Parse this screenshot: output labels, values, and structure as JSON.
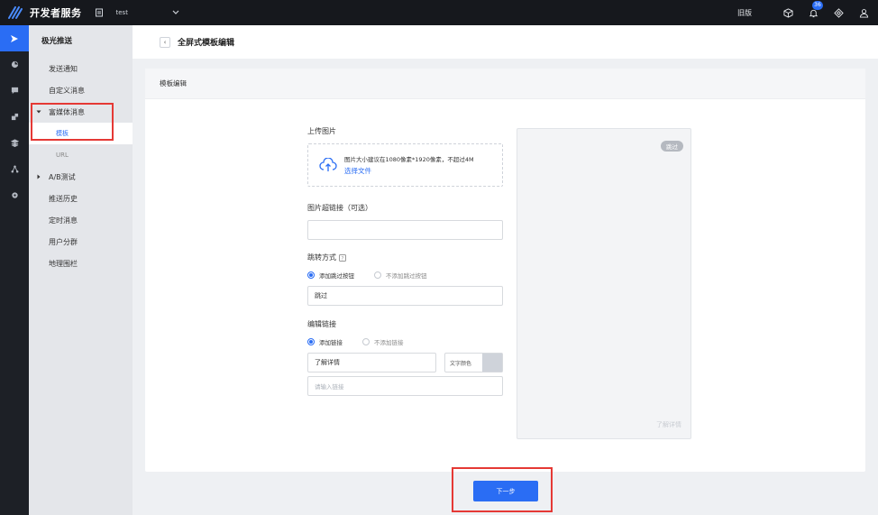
{
  "topbar": {
    "brand": "开发者服务",
    "app_name": "test",
    "old_version": "旧版",
    "notification_count": "36"
  },
  "sidebar": {
    "title": "极光推送",
    "items": [
      {
        "label": "发送通知"
      },
      {
        "label": "自定义消息"
      },
      {
        "label": "富媒体消息"
      },
      {
        "label": "A/B测试"
      },
      {
        "label": "推送历史"
      },
      {
        "label": "定时消息"
      },
      {
        "label": "用户分群"
      },
      {
        "label": "地理围栏"
      }
    ],
    "sub_items": [
      {
        "label": "模板"
      },
      {
        "label": "URL"
      }
    ]
  },
  "header": {
    "back": "‹",
    "title": "全屏式模板编辑"
  },
  "card": {
    "title": "模板编辑",
    "upload_label": "上传图片",
    "upload_hint": "图片大小建议在1080像素*1920像素，不超过4M",
    "upload_link": "选择文件",
    "link_label": "图片超链接（可选）",
    "link_value": "",
    "jump_label": "跳转方式",
    "jump_options": [
      "添加跳过按钮",
      "不添加跳过按钮"
    ],
    "skip_text": "跳过",
    "edit_link_label": "编辑链接",
    "edit_link_options": [
      "添加链接",
      "不添加链接"
    ],
    "detail_text": "了解详情",
    "text_color_label": "文字颜色",
    "link_placeholder": "请输入链接"
  },
  "preview": {
    "skip": "跳过",
    "detail": "了解详情"
  },
  "footer": {
    "next": "下一步"
  },
  "colors": {
    "accent": "#2a6df4",
    "topbar": "#16181d",
    "highlight": "#e53935"
  }
}
